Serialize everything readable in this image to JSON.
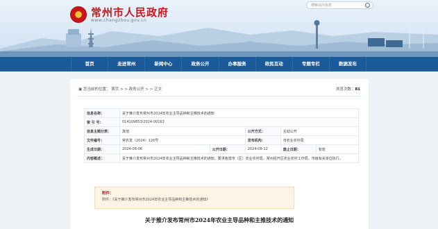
{
  "header": {
    "title": "常州市人民政府",
    "url": "www.changzhou.gov.cn",
    "search_placeholder": "搜索站内信息"
  },
  "nav": [
    "首页",
    "走进常州",
    "新闻中心",
    "政务公开",
    "办事服务",
    "政民互动",
    "专题专栏",
    "数据发布"
  ],
  "breadcrumb": {
    "label": "您当前的位置：",
    "path": "首页 > > 政务公开 > > 正文"
  },
  "views": {
    "label": "浏览次数：",
    "count": "81"
  },
  "info": {
    "index_title": {
      "label": "信息名称：",
      "value": "关于推介发布常州市2024年农业主导品种和主推技术的通知"
    },
    "index_no": {
      "label": "索 引 号：",
      "value": "014109853/2024-00163"
    },
    "theme": {
      "label": "信息主题分类：",
      "value": "其他"
    },
    "open_method": {
      "label": "公开方式：",
      "value": "主动公开"
    },
    "doc_no": {
      "label": "文件编号：",
      "value": "常农发〔2024〕126号"
    },
    "issuer": {
      "label": "发布机构：",
      "value": "市农业农村局"
    },
    "generated": {
      "label": "生成日期：",
      "value": "2024-08-06"
    },
    "published": {
      "label": "公开日期：",
      "value": "2024-08-12"
    },
    "valid": {
      "label": "废止日期：",
      "value": "有效"
    },
    "summary": {
      "label": "内容概述：",
      "value": "关于推介发布常州市2024年农业主导品种和主推技术的通知，要求各辖市（区）农业农村局，常州经开区农业农村工作局，市级有关单位执行。"
    }
  },
  "attachment": {
    "title": "附件：",
    "item": "附件：《关于推介发布常州市2024年农业主导品种和主推技术的通知》"
  },
  "doc_title": "关于推介发布常州市2024年农业主导品种和主推技术的通知"
}
